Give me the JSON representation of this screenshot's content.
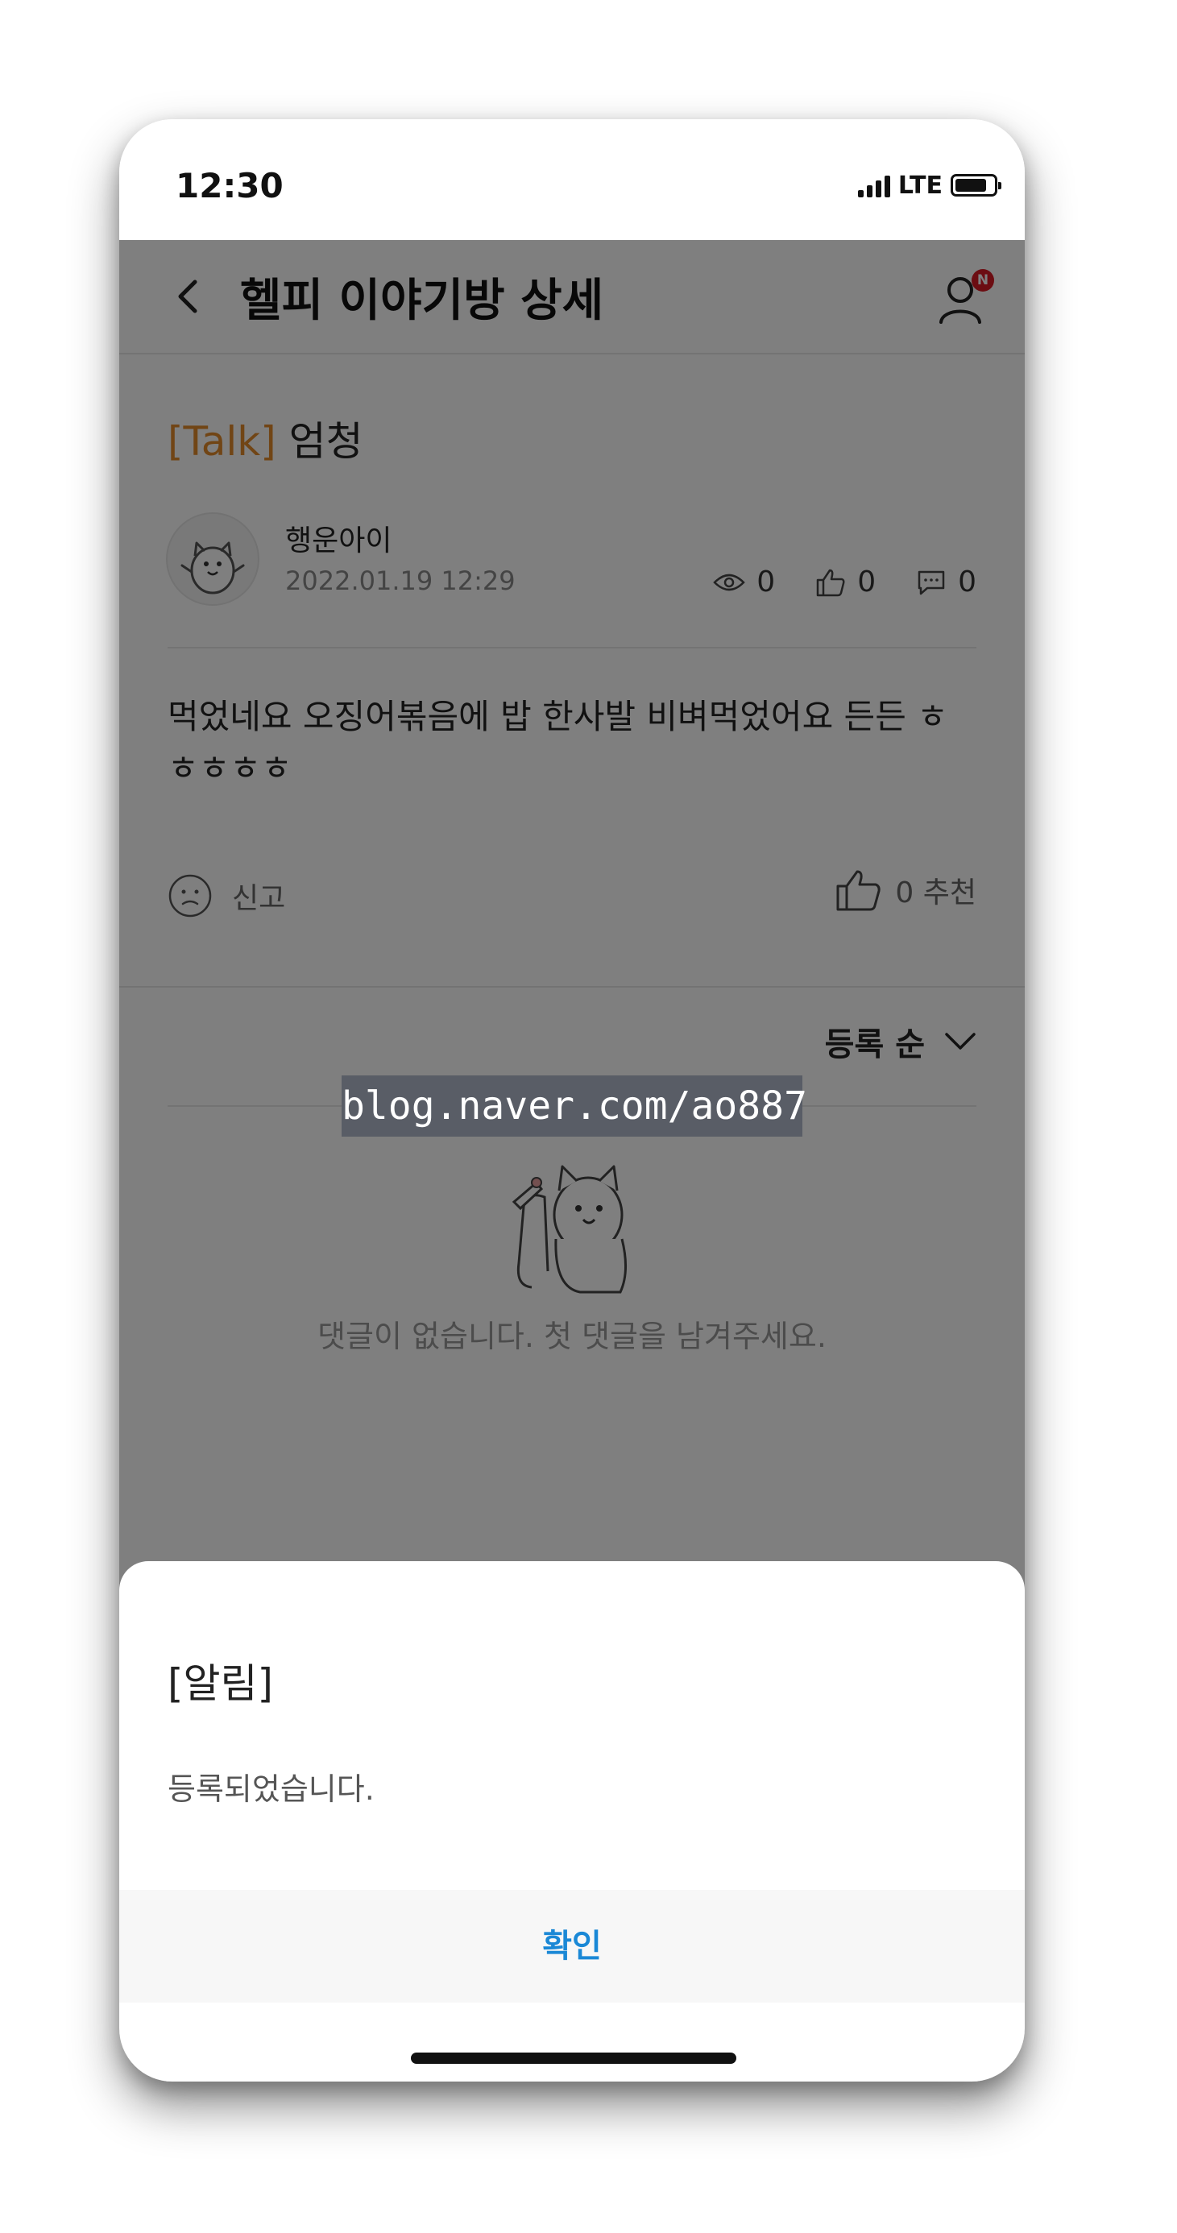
{
  "status_bar": {
    "time": "12:30",
    "network": "LTE"
  },
  "header": {
    "title": "헬피 이야기방 상세",
    "notification_badge": "N"
  },
  "post": {
    "tag": "[Talk]",
    "title": "엄청",
    "author": "행운아이",
    "date": "2022.01.19 12:29",
    "views": "0",
    "likes": "0",
    "comments": "0",
    "body": "먹었네요 오징어볶음에 밥 한사발 비벼먹었어요 든든 ㅎㅎㅎㅎㅎ",
    "report_label": "신고",
    "recommend_label": "0 추천"
  },
  "comments": {
    "sort_label": "등록 순",
    "empty_message": "댓글이 없습니다. 첫 댓글을 남겨주세요."
  },
  "watermark": "blog.naver.com/ao887",
  "alert": {
    "title": "[알림]",
    "message": "등록되었습니다.",
    "confirm_label": "확인"
  },
  "colors": {
    "tag": "#e38a2a",
    "badge": "#d81b25",
    "confirm": "#1a88d6"
  }
}
